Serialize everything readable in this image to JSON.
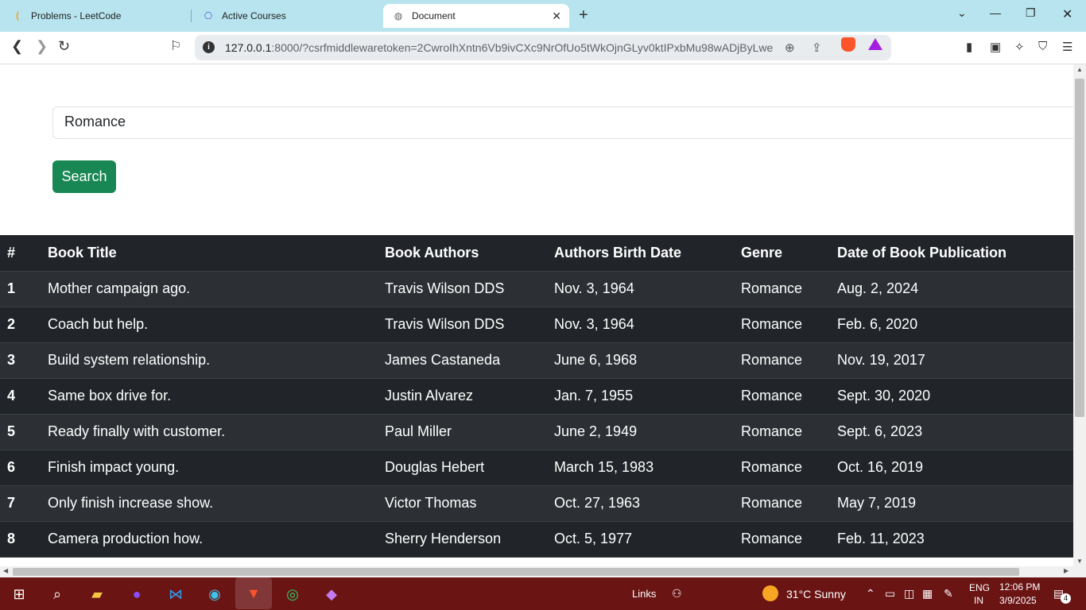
{
  "browser": {
    "tabs": [
      {
        "title": "Problems - LeetCode",
        "icon": "leetcode-icon"
      },
      {
        "title": "Active Courses",
        "icon": "courses-icon"
      },
      {
        "title": "Document",
        "icon": "globe-icon",
        "active": true
      }
    ],
    "url": {
      "host": "127.0.0.1",
      "rest": ":8000/?csrfmiddlewaretoken=2CwroIhXntn6Vb9ivCXc9NrOfUo5tWkOjnGLyv0ktIPxbMu98wADjByLweL..."
    }
  },
  "search": {
    "value": "Romance",
    "button_label": "Search"
  },
  "table": {
    "headers": [
      "#",
      "Book Title",
      "Book Authors",
      "Authors Birth Date",
      "Genre",
      "Date of Book Publication"
    ],
    "rows": [
      {
        "num": "1",
        "title": "Mother campaign ago.",
        "author": "Travis Wilson DDS",
        "birth": "Nov. 3, 1964",
        "genre": "Romance",
        "published": "Aug. 2, 2024"
      },
      {
        "num": "2",
        "title": "Coach but help.",
        "author": "Travis Wilson DDS",
        "birth": "Nov. 3, 1964",
        "genre": "Romance",
        "published": "Feb. 6, 2020"
      },
      {
        "num": "3",
        "title": "Build system relationship.",
        "author": "James Castaneda",
        "birth": "June 6, 1968",
        "genre": "Romance",
        "published": "Nov. 19, 2017"
      },
      {
        "num": "4",
        "title": "Same box drive for.",
        "author": "Justin Alvarez",
        "birth": "Jan. 7, 1955",
        "genre": "Romance",
        "published": "Sept. 30, 2020"
      },
      {
        "num": "5",
        "title": "Ready finally with customer.",
        "author": "Paul Miller",
        "birth": "June 2, 1949",
        "genre": "Romance",
        "published": "Sept. 6, 2023"
      },
      {
        "num": "6",
        "title": "Finish impact young.",
        "author": "Douglas Hebert",
        "birth": "March 15, 1983",
        "genre": "Romance",
        "published": "Oct. 16, 2019"
      },
      {
        "num": "7",
        "title": "Only finish increase show.",
        "author": "Victor Thomas",
        "birth": "Oct. 27, 1963",
        "genre": "Romance",
        "published": "May 7, 2019"
      },
      {
        "num": "8",
        "title": "Camera production how.",
        "author": "Sherry Henderson",
        "birth": "Oct. 5, 1977",
        "genre": "Romance",
        "published": "Feb. 11, 2023"
      }
    ]
  },
  "taskbar": {
    "links_label": "Links",
    "weather": "31°C  Sunny",
    "lang_top": "ENG",
    "lang_bottom": "IN",
    "time": "12:06 PM",
    "date": "3/9/2025",
    "notification_count": "4"
  },
  "colors": {
    "tabstrip": "#b7e4ef",
    "search_button": "#198754",
    "table_dark": "#212529",
    "table_stripe": "#2c3034",
    "taskbar": "#6b1414"
  }
}
